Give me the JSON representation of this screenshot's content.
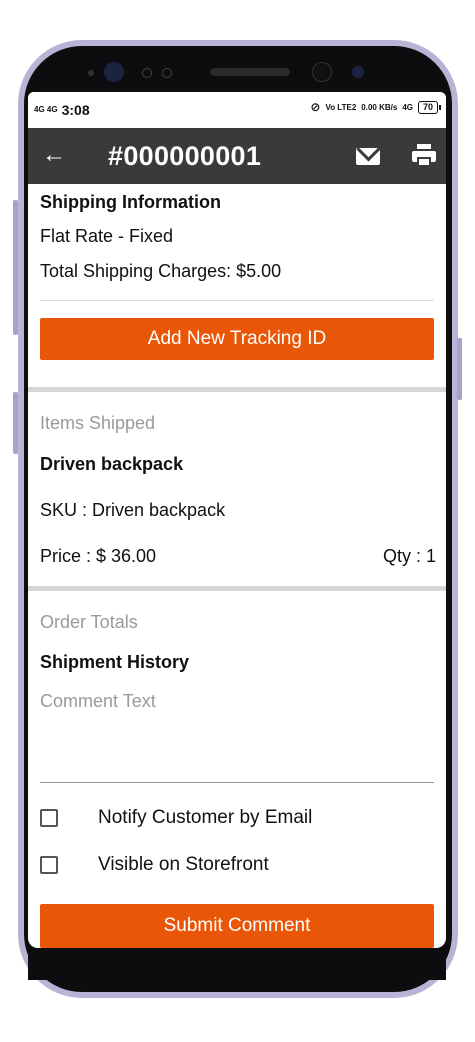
{
  "status_bar": {
    "signal": "4G 4G",
    "time": "3:08",
    "network": "Vo LTE2",
    "speed": "0.00 KB/s",
    "net_type": "4G",
    "battery": "70"
  },
  "toolbar": {
    "title": "#000000001",
    "icons": [
      "back-arrow-icon",
      "mail-icon",
      "printer-icon"
    ]
  },
  "shipping": {
    "heading": "Shipping Information",
    "method": "Flat Rate - Fixed",
    "charges": "Total Shipping Charges: $5.00",
    "add_tracking_label": "Add New Tracking ID"
  },
  "items": {
    "heading": "Items Shipped",
    "name": "Driven backpack",
    "sku": "SKU :  Driven backpack",
    "price": "Price :  $ 36.00",
    "qty": "Qty : 1"
  },
  "totals": {
    "heading": "Order Totals",
    "history_heading": "Shipment History",
    "comment_placeholder": "Comment Text",
    "notify_label": "Notify Customer by Email",
    "visible_label": "Visible on Storefront",
    "submit_label": "Submit Comment"
  },
  "colors": {
    "accent": "#ea5608",
    "toolbar": "#3b3a38"
  }
}
